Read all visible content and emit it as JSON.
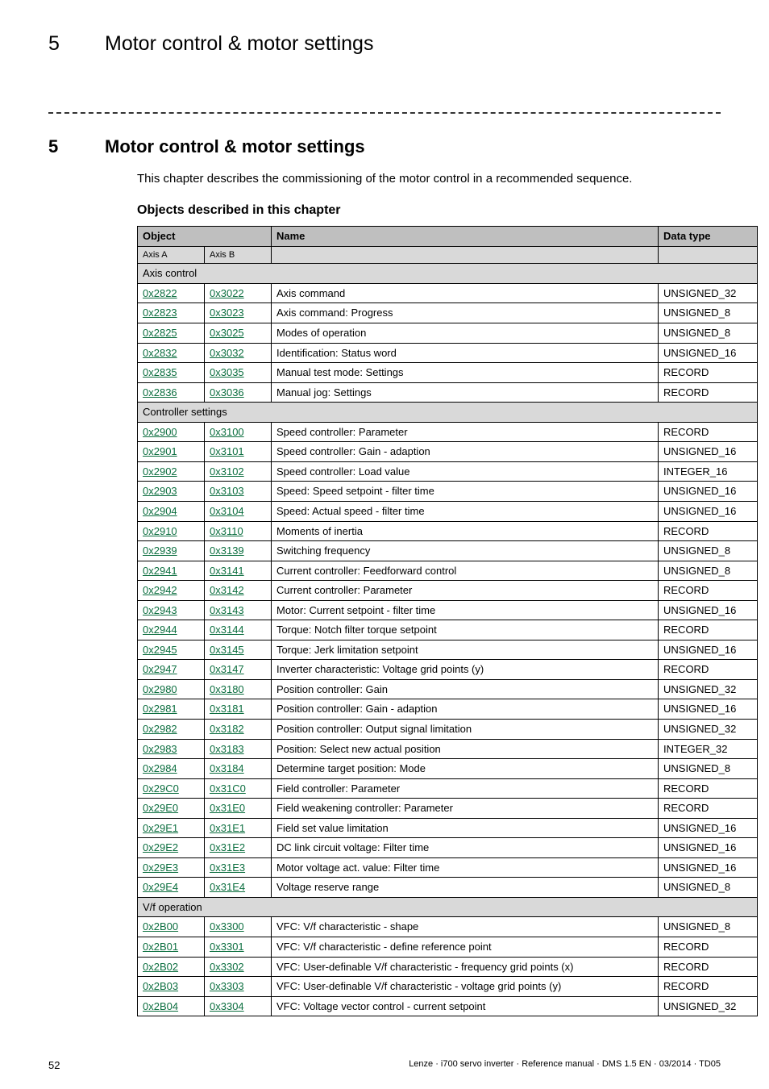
{
  "header": {
    "chapter_num": "5",
    "chapter_title": "Motor control & motor settings"
  },
  "h1": {
    "num": "5",
    "title": "Motor control & motor settings"
  },
  "intro": "This chapter describes the commissioning of the motor control in a recommended sequence.",
  "subhead": "Objects described in this chapter",
  "table": {
    "head": {
      "object": "Object",
      "name": "Name",
      "datatype": "Data type",
      "axisA": "Axis A",
      "axisB": "Axis B"
    },
    "sections": [
      {
        "title": "Axis control",
        "rows": [
          {
            "a": "0x2822",
            "b": "0x3022",
            "name": "Axis command",
            "type": "UNSIGNED_32"
          },
          {
            "a": "0x2823",
            "b": "0x3023",
            "name": "Axis command: Progress",
            "type": "UNSIGNED_8"
          },
          {
            "a": "0x2825",
            "b": "0x3025",
            "name": "Modes of operation",
            "type": "UNSIGNED_8"
          },
          {
            "a": "0x2832",
            "b": "0x3032",
            "name": "Identification: Status word",
            "type": "UNSIGNED_16"
          },
          {
            "a": "0x2835",
            "b": "0x3035",
            "name": "Manual test mode: Settings",
            "type": "RECORD"
          },
          {
            "a": "0x2836",
            "b": "0x3036",
            "name": "Manual jog: Settings",
            "type": "RECORD"
          }
        ]
      },
      {
        "title": "Controller settings",
        "rows": [
          {
            "a": "0x2900",
            "b": "0x3100",
            "name": "Speed controller: Parameter",
            "type": "RECORD"
          },
          {
            "a": "0x2901",
            "b": "0x3101",
            "name": "Speed controller: Gain - adaption",
            "type": "UNSIGNED_16"
          },
          {
            "a": "0x2902",
            "b": "0x3102",
            "name": "Speed controller: Load value",
            "type": "INTEGER_16"
          },
          {
            "a": "0x2903",
            "b": "0x3103",
            "name": "Speed: Speed setpoint - filter time",
            "type": "UNSIGNED_16"
          },
          {
            "a": "0x2904",
            "b": "0x3104",
            "name": "Speed: Actual speed - filter time",
            "type": "UNSIGNED_16"
          },
          {
            "a": "0x2910",
            "b": "0x3110",
            "name": "Moments of inertia",
            "type": "RECORD"
          },
          {
            "a": "0x2939",
            "b": "0x3139",
            "name": "Switching frequency",
            "type": "UNSIGNED_8"
          },
          {
            "a": "0x2941",
            "b": "0x3141",
            "name": "Current controller: Feedforward control",
            "type": "UNSIGNED_8"
          },
          {
            "a": "0x2942",
            "b": "0x3142",
            "name": "Current controller: Parameter",
            "type": "RECORD"
          },
          {
            "a": "0x2943",
            "b": "0x3143",
            "name": "Motor: Current setpoint - filter time",
            "type": "UNSIGNED_16"
          },
          {
            "a": "0x2944",
            "b": "0x3144",
            "name": "Torque: Notch filter torque setpoint",
            "type": "RECORD"
          },
          {
            "a": "0x2945",
            "b": "0x3145",
            "name": "Torque: Jerk limitation setpoint",
            "type": "UNSIGNED_16"
          },
          {
            "a": "0x2947",
            "b": "0x3147",
            "name": "Inverter characteristic: Voltage grid points (y)",
            "type": "RECORD"
          },
          {
            "a": "0x2980",
            "b": "0x3180",
            "name": "Position controller: Gain",
            "type": "UNSIGNED_32"
          },
          {
            "a": "0x2981",
            "b": "0x3181",
            "name": "Position controller: Gain - adaption",
            "type": "UNSIGNED_16"
          },
          {
            "a": "0x2982",
            "b": "0x3182",
            "name": "Position controller: Output signal limitation",
            "type": "UNSIGNED_32"
          },
          {
            "a": "0x2983",
            "b": "0x3183",
            "name": "Position: Select new actual position",
            "type": "INTEGER_32"
          },
          {
            "a": "0x2984",
            "b": "0x3184",
            "name": "Determine target position: Mode",
            "type": "UNSIGNED_8"
          },
          {
            "a": "0x29C0",
            "b": "0x31C0",
            "name": "Field controller: Parameter",
            "type": "RECORD"
          },
          {
            "a": "0x29E0",
            "b": "0x31E0",
            "name": "Field weakening controller: Parameter",
            "type": "RECORD"
          },
          {
            "a": "0x29E1",
            "b": "0x31E1",
            "name": "Field set value limitation",
            "type": "UNSIGNED_16"
          },
          {
            "a": "0x29E2",
            "b": "0x31E2",
            "name": "DC link circuit voltage: Filter time",
            "type": "UNSIGNED_16"
          },
          {
            "a": "0x29E3",
            "b": "0x31E3",
            "name": "Motor voltage act. value: Filter time",
            "type": "UNSIGNED_16"
          },
          {
            "a": "0x29E4",
            "b": "0x31E4",
            "name": "Voltage reserve range",
            "type": "UNSIGNED_8"
          }
        ]
      },
      {
        "title": "V/f operation",
        "rows": [
          {
            "a": "0x2B00",
            "b": "0x3300",
            "name": "VFC: V/f characteristic - shape",
            "type": "UNSIGNED_8"
          },
          {
            "a": "0x2B01",
            "b": "0x3301",
            "name": "VFC: V/f characteristic - define reference point",
            "type": "RECORD"
          },
          {
            "a": "0x2B02",
            "b": "0x3302",
            "name": "VFC: User-definable V/f characteristic - frequency grid points (x)",
            "type": "RECORD"
          },
          {
            "a": "0x2B03",
            "b": "0x3303",
            "name": "VFC: User-definable V/f characteristic - voltage grid points (y)",
            "type": "RECORD"
          },
          {
            "a": "0x2B04",
            "b": "0x3304",
            "name": "VFC: Voltage vector control - current setpoint",
            "type": "UNSIGNED_32"
          }
        ]
      }
    ]
  },
  "footer": {
    "page": "52",
    "ref": "Lenze · i700 servo inverter · Reference manual · DMS 1.5 EN · 03/2014 · TD05"
  }
}
